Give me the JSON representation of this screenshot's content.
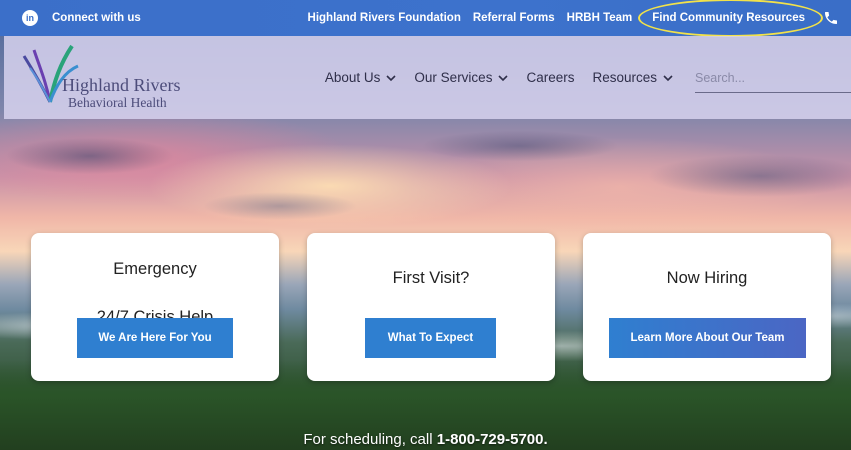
{
  "topbar": {
    "connect_label": "Connect with us",
    "linkedin_icon": "linkedin-icon",
    "links": [
      "Highland Rivers Foundation",
      "Referral Forms",
      "HRBH Team"
    ],
    "highlighted_link": "Find Community Resources",
    "phone_icon": "phone-icon",
    "highlight_color": "#f2e24a"
  },
  "logo": {
    "line1": "Highland Rivers",
    "line2": "Behavioral Health"
  },
  "nav": {
    "items": [
      "About Us",
      "Our Services",
      "Careers",
      "Resources"
    ],
    "search_placeholder": "Search..."
  },
  "cards": [
    {
      "title_line1": "Emergency",
      "title_line2": "24/7 Crisis Help",
      "button": "We Are Here For You"
    },
    {
      "title_line1": "First Visit?",
      "button": "What To Expect"
    },
    {
      "title_line1": "Now Hiring",
      "button": "Learn More About Our Team"
    }
  ],
  "footer": {
    "schedule_prefix": "For scheduling, call",
    "schedule_phone": "1-800-729-5700."
  },
  "colors": {
    "topbar": "#3b6fc9",
    "button": "#2f7fd0",
    "nav_bg": "#d6d2ee"
  }
}
